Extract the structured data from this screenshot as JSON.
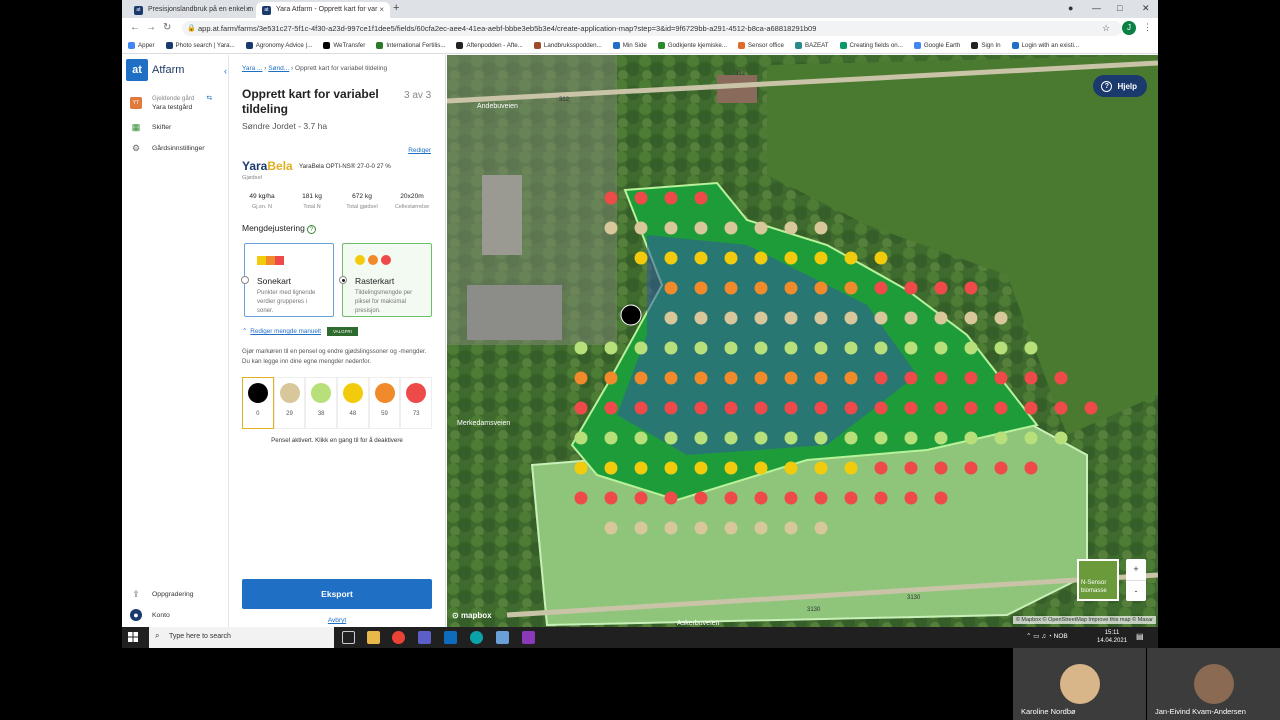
{
  "browser": {
    "tabs": [
      {
        "label": "Presisjonslandbruk på en enkel m",
        "favicon": "at"
      },
      {
        "label": "Yara Atfarm - Opprett kart for var",
        "favicon": "at"
      }
    ],
    "url": "app.at.farm/farms/3e531c27-5f1c-4f30-a23d-997ce1f1dee5/fields/60cfa2ec-aee4-41ea-aebf-bbbe3eb5b3e4/create-application-map?step=3&id=9f6729bb-a291-4512-b8ca-a68818291b09",
    "avatar_letter": "J",
    "bookmarks": [
      "Apper",
      "Photo search | Yara...",
      "Agronomy Advice |...",
      "WeTransfer",
      "International Fertilis...",
      "Aftenpodden - Afte...",
      "Landbruksspodden...",
      "Min Side",
      "Godkjente kjemiske...",
      "Sensor office",
      "BAZEAT",
      "Creating fields on...",
      "Google Earth",
      "Sign In",
      "Login with an existi..."
    ]
  },
  "leftnav": {
    "logo": "at",
    "app_name": "Atfarm",
    "farm_label": "Gjeldende gård",
    "farm_name": "Yara testgård",
    "farm_badge": "YT",
    "items": [
      {
        "label": "Skifter"
      },
      {
        "label": "Gårdsinnstillinger"
      }
    ],
    "bottom_items": [
      {
        "label": "Oppgradering"
      },
      {
        "label": "Konto"
      }
    ]
  },
  "panel": {
    "breadcrumb": [
      "Yara ...",
      "Sønd...",
      "Opprett kart for variabel tildeling"
    ],
    "title": "Opprett kart for variabel tildeling",
    "step": "3 av 3",
    "field": "Søndre Jordet - 3.7 ha",
    "edit_link": "Rediger",
    "brand_a": "Yara",
    "brand_b": "Bela",
    "product": "YaraBela OPTI-NS® 27-0-0 27 %",
    "category": "Gjødsel",
    "stats": [
      {
        "value": "49 kg/ha",
        "label": "Gj.sn. N"
      },
      {
        "value": "181 kg",
        "label": "Total N"
      },
      {
        "value": "672 kg",
        "label": "Total gjødsel"
      },
      {
        "value": "20x20m",
        "label": "Cellestørrelse"
      }
    ],
    "section_title": "Mengdejustering",
    "options": [
      {
        "title": "Sonekart",
        "desc": "Punkter med lignende verdier grupperes i soner."
      },
      {
        "title": "Rasterkart",
        "desc": "Tildelingsmengde per piksel for maksimal presisjon."
      }
    ],
    "manual_link": "Rediger mengde manuelt",
    "optional_badge": "VALGFRI",
    "instructions": "Gjør markøren til en pensel og endre gjødslingssoner og -mengder. Du kan legge inn dine egne mengder nedenfor.",
    "palette": [
      {
        "value": "0",
        "color": "#000000"
      },
      {
        "value": "29",
        "color": "#d8c79a"
      },
      {
        "value": "38",
        "color": "#b8e07a"
      },
      {
        "value": "48",
        "color": "#f2cc0c"
      },
      {
        "value": "59",
        "color": "#f08a2a"
      },
      {
        "value": "73",
        "color": "#ef4a4a"
      }
    ],
    "brush_status": "Pensel aktivert. Klikk en gang til for å deaktivere",
    "export_label": "Eksport",
    "cancel_label": "Avbryt"
  },
  "map": {
    "help_label": "Hjelp",
    "layer_label": "N-Sensor biomasse",
    "zoom_in": "+",
    "zoom_out": "-",
    "provider": "mapbox",
    "attribution": "© Mapbox © OpenStreetMap Improve this map © Maxar",
    "road_labels": [
      "Andebuveien",
      "312",
      "312",
      "Merkedamsveien",
      "3130",
      "3130",
      "Askerbuveien"
    ]
  },
  "taskbar": {
    "search_placeholder": "Type here to search",
    "tray_lang": "NOB",
    "time": "15:11",
    "date": "14.04.2021"
  },
  "participants": [
    {
      "name": "Karoline Nordbø"
    },
    {
      "name": "Jan-Eivind Kvam-Andersen"
    }
  ]
}
